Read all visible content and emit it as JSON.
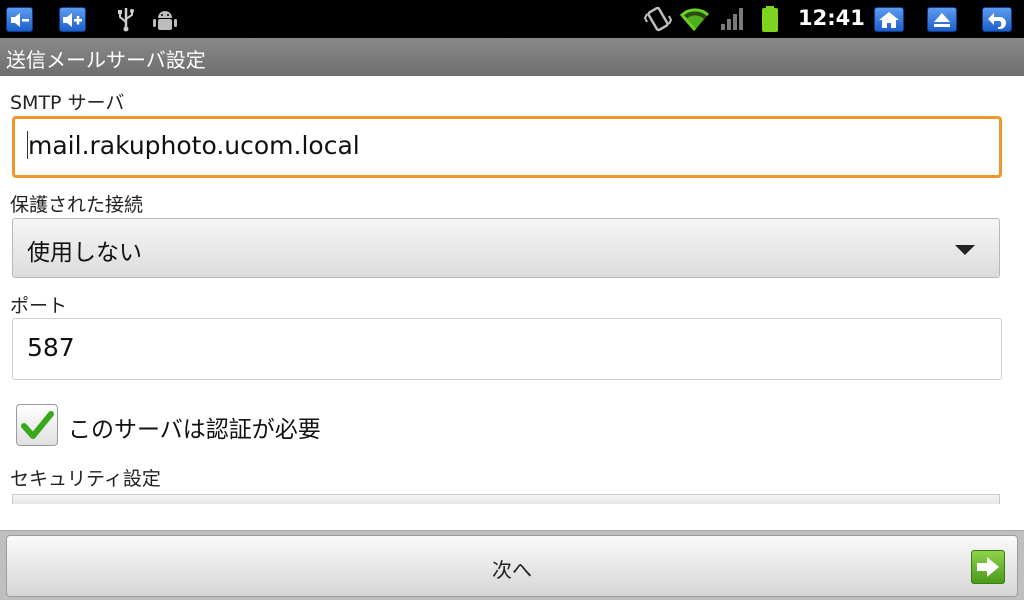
{
  "status_bar": {
    "time": "12:41",
    "icons": [
      "volume-down-icon",
      "volume-up-icon",
      "usb-icon",
      "android-debug-icon",
      "vibrate-icon",
      "wifi-icon",
      "signal-icon",
      "battery-icon",
      "home-icon",
      "eject-icon",
      "back-icon"
    ]
  },
  "header": {
    "title": "送信メールサーバ設定"
  },
  "form": {
    "smtp_label": "SMTP サーバ",
    "smtp_value": "mail.rakuphoto.ucom.local",
    "secure_label": "保護された接続",
    "secure_value": "使用しない",
    "port_label": "ポート",
    "port_value": "587",
    "auth_checkbox_label": "このサーバは認証が必要",
    "auth_checked": true,
    "security_label": "セキュリティ設定"
  },
  "footer": {
    "next_label": "次へ"
  },
  "colors": {
    "focus_border": "#f0962a",
    "accent_blue": "#1c5fc9",
    "check_green": "#3aa81c"
  }
}
